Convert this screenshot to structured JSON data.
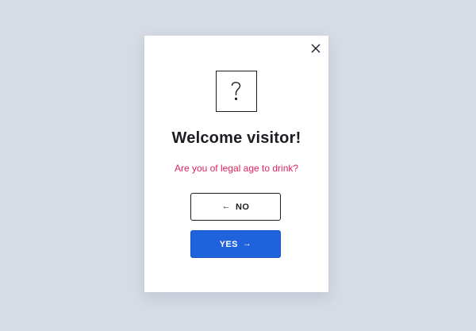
{
  "modal": {
    "close_icon": "close-icon",
    "question_icon": "question-mark-icon",
    "title": "Welcome visitor!",
    "subtitle": "Are you of legal age to drink?",
    "no_button": {
      "label": "NO",
      "icon": "arrow-left-icon",
      "arrow_glyph": "←"
    },
    "yes_button": {
      "label": "YES",
      "icon": "arrow-right-icon",
      "arrow_glyph": "→"
    }
  },
  "colors": {
    "background": "#d6dbe5",
    "modal": "#ffffff",
    "text": "#1c1c24",
    "accent_text": "#e0245e",
    "primary_button": "#1f63dc"
  }
}
